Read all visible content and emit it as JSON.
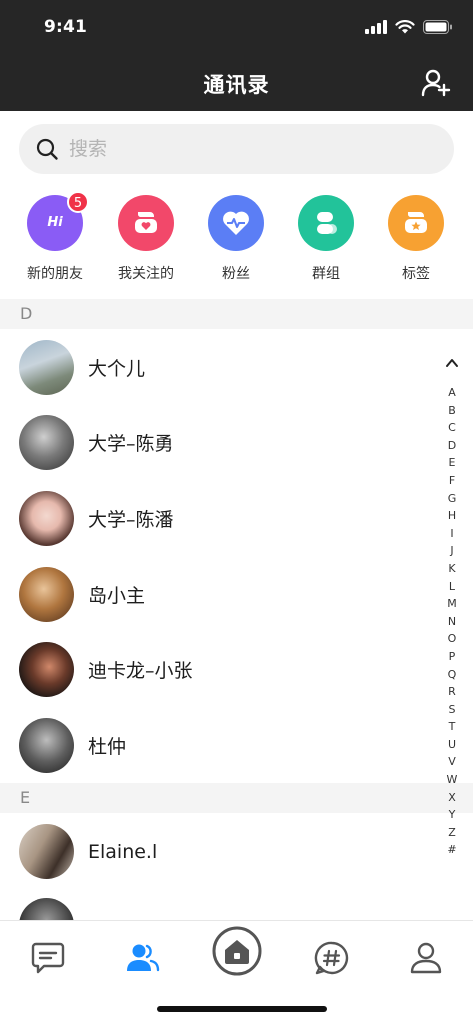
{
  "status": {
    "time": "9:41"
  },
  "header": {
    "title": "通讯录"
  },
  "search": {
    "placeholder": "搜索"
  },
  "shortcuts": [
    {
      "label": "新的朋友",
      "icon": "hi-icon",
      "color": "#8a5cf5",
      "badge": "5"
    },
    {
      "label": "我关注的",
      "icon": "heart-icon",
      "color": "#f2486a"
    },
    {
      "label": "粉丝",
      "icon": "heartbeat-icon",
      "color": "#5b7ef5"
    },
    {
      "label": "群组",
      "icon": "group-icon",
      "color": "#22c39a"
    },
    {
      "label": "标签",
      "icon": "star-tag-icon",
      "color": "#f7a132"
    }
  ],
  "sections": [
    {
      "letter": "D",
      "contacts": [
        "大个儿",
        "大学–陈勇",
        "大学–陈潘",
        "岛小主",
        "迪卡龙–小张",
        "杜仲"
      ]
    },
    {
      "letter": "E",
      "contacts": [
        "Elaine.l"
      ]
    }
  ],
  "index_letters": [
    "A",
    "B",
    "C",
    "D",
    "E",
    "F",
    "G",
    "H",
    "I",
    "J",
    "K",
    "L",
    "M",
    "N",
    "O",
    "P",
    "Q",
    "R",
    "S",
    "T",
    "U",
    "V",
    "W",
    "X",
    "Y",
    "Z",
    "#"
  ],
  "tabbar": {
    "tabs": [
      "chat-icon",
      "contacts-icon",
      "home-icon",
      "topic-icon",
      "profile-icon"
    ],
    "active_color": "#1a8cff"
  }
}
